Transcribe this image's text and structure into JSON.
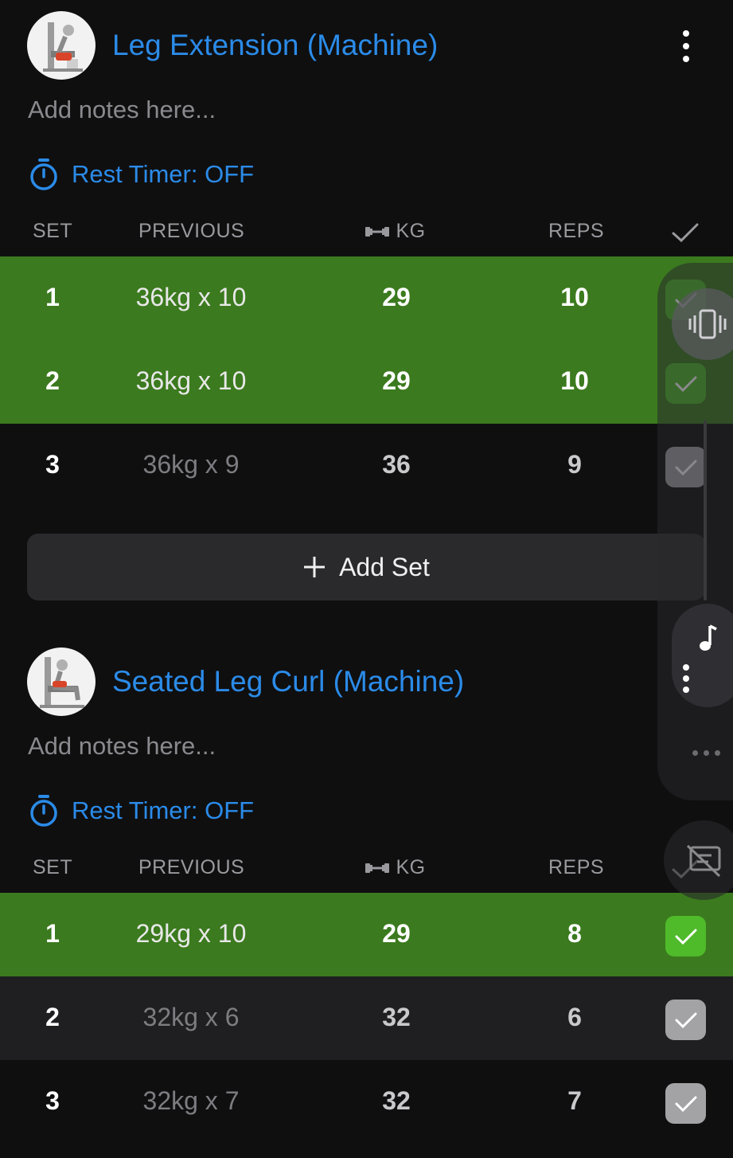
{
  "exercises": [
    {
      "title": "Leg Extension (Machine)",
      "notes_placeholder": "Add notes here...",
      "rest_timer": "Rest Timer: OFF",
      "columns": {
        "set": "SET",
        "previous": "PREVIOUS",
        "kg": "KG",
        "reps": "REPS"
      },
      "sets": [
        {
          "set": "1",
          "previous": "36kg x 10",
          "kg": "29",
          "reps": "10",
          "completed": true
        },
        {
          "set": "2",
          "previous": "36kg x 10",
          "kg": "29",
          "reps": "10",
          "completed": true
        },
        {
          "set": "3",
          "previous": "36kg x 9",
          "kg": "36",
          "reps": "9",
          "completed": false
        }
      ],
      "add_set_label": "Add Set"
    },
    {
      "title": "Seated Leg Curl (Machine)",
      "notes_placeholder": "Add notes here...",
      "rest_timer": "Rest Timer: OFF",
      "columns": {
        "set": "SET",
        "previous": "PREVIOUS",
        "kg": "KG",
        "reps": "REPS"
      },
      "sets": [
        {
          "set": "1",
          "previous": "29kg x 10",
          "kg": "29",
          "reps": "8",
          "completed": true
        },
        {
          "set": "2",
          "previous": "32kg x 6",
          "kg": "32",
          "reps": "6",
          "completed": false
        },
        {
          "set": "3",
          "previous": "32kg x 7",
          "kg": "32",
          "reps": "7",
          "completed": false
        }
      ]
    }
  ],
  "colors": {
    "accent_blue": "#2b8be8",
    "completed_row": "#3b7a1e",
    "completed_check": "#4fba2a",
    "pending_check": "#a3a3a6",
    "background": "#0f0f10"
  },
  "icons": {
    "exercise_menu": "vertical-dots-icon",
    "rest_timer": "stopwatch-icon",
    "kg_column": "dumbbell-icon",
    "complete_column": "checkmark-icon",
    "add_set": "plus-icon",
    "overlay": [
      "vibrate-icon",
      "music-note-icon",
      "more-dots-icon",
      "screen-off-icon"
    ]
  }
}
